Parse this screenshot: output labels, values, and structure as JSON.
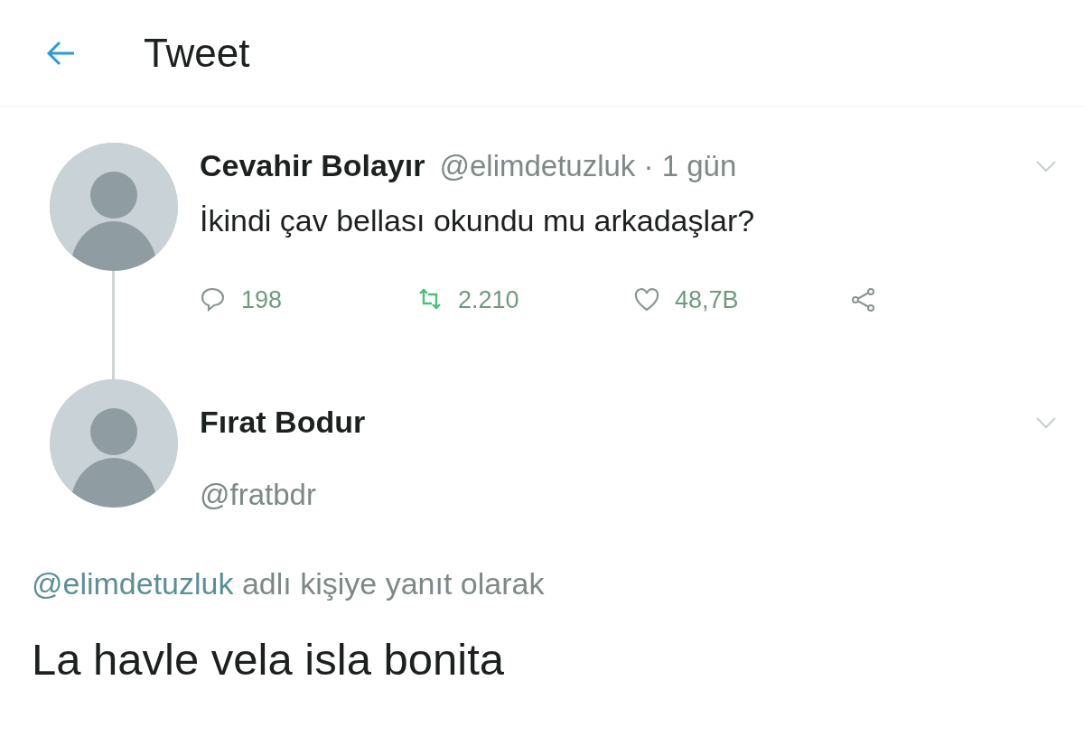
{
  "header": {
    "title": "Tweet"
  },
  "tweet": {
    "author": "Cevahir Bolayır",
    "meta": "@elimdetuzluk · 1 gün",
    "text": "İkindi çav bellası okundu mu arkadaşlar?",
    "actions": [
      {
        "kind": "reply",
        "count": "198"
      },
      {
        "kind": "retweet",
        "count": "2.210"
      },
      {
        "kind": "like",
        "count": "48,7B"
      },
      {
        "kind": "share"
      }
    ]
  },
  "reply": {
    "author": "Fırat Bodur",
    "handle": "@fratbdr",
    "reply_to": {
      "mention": "@elimdetuzluk",
      "text": "adlı kişiye yanıt olarak"
    },
    "text": "La havle vela isla bonita"
  }
}
